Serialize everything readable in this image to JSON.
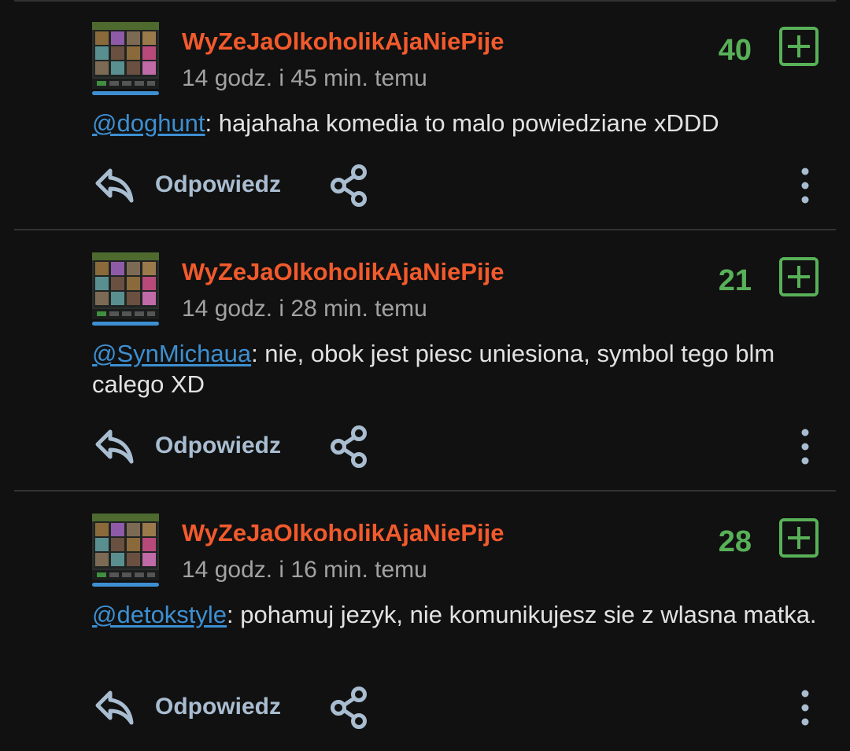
{
  "comments": [
    {
      "username": "WyZeJaOlkoholikAjaNiePije",
      "timestamp": "14 godz. i 45 min. temu",
      "score": "40",
      "mention": "@doghunt",
      "text": ": hajahaha komedia to malo powiedziane xDDD",
      "reply_label": "Odpowiedz"
    },
    {
      "username": "WyZeJaOlkoholikAjaNiePije",
      "timestamp": "14 godz. i 28 min. temu",
      "score": "21",
      "mention": "@SynMichaua",
      "text": ": nie, obok jest piesc uniesiona, symbol tego blm calego XD",
      "reply_label": "Odpowiedz"
    },
    {
      "username": "WyZeJaOlkoholikAjaNiePije",
      "timestamp": "14 godz. i 16 min. temu",
      "score": "28",
      "mention": "@detokstyle",
      "text": ": pohamuj jezyk, nie komunikujesz sie z wlasna matka.",
      "reply_label": "Odpowiedz"
    }
  ],
  "icons": {
    "avatar": "slot-machine-avatar",
    "vote": "plus-icon",
    "reply": "reply-arrow-icon",
    "share": "share-icon",
    "more": "more-vertical-icon"
  },
  "colors": {
    "background": "#111111",
    "username": "#f25a2c",
    "score": "#58b158",
    "mention": "#3d8fd1",
    "action": "#a9bdd1",
    "timestamp": "#a2a2a2"
  }
}
